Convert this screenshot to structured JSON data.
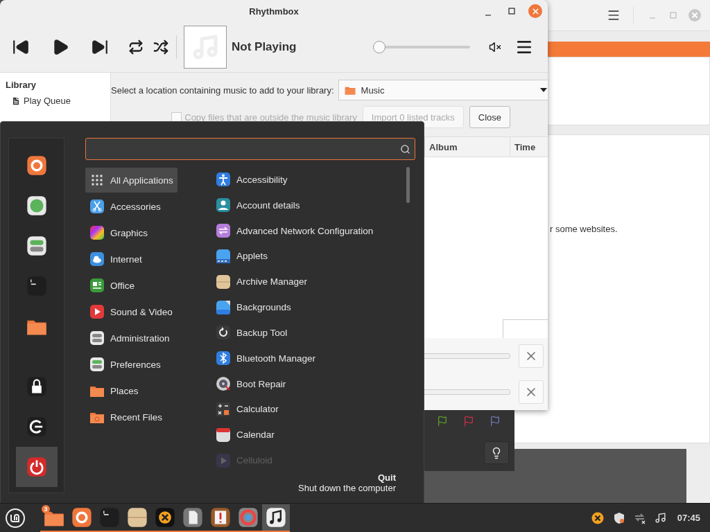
{
  "rhythmbox": {
    "title": "Rhythmbox",
    "now_playing": "Not Playing",
    "volume": {
      "level": 0,
      "muted": true
    },
    "sidebar": {
      "heading": "Library",
      "items": [
        {
          "label": "Play Queue"
        }
      ]
    },
    "import_bar": {
      "prompt": "Select a location containing music to add to your library:",
      "location": "Music",
      "copy_files": {
        "label": "Copy files that are outside the music library",
        "checked": false,
        "disabled": true
      },
      "buttons": [
        {
          "label": "Import 0 listed tracks",
          "disabled": true
        },
        {
          "label": "Close",
          "disabled": false
        }
      ]
    },
    "columns": [
      "Album",
      "Time"
    ],
    "transfers": [
      {
        "level": 0
      },
      {
        "level": 0
      }
    ]
  },
  "background_window": {
    "text": "r some websites."
  },
  "menu": {
    "favorites": [
      {
        "selected": false
      },
      {
        "selected": false
      },
      {
        "selected": false
      },
      {
        "selected": false
      },
      {
        "selected": false
      },
      {
        "selected": false
      },
      {
        "selected": false
      },
      {
        "selected": true
      }
    ],
    "categories": [
      {
        "label": "All Applications",
        "selected": true
      },
      {
        "label": "Accessories",
        "selected": false
      },
      {
        "label": "Graphics",
        "selected": false
      },
      {
        "label": "Internet",
        "selected": false
      },
      {
        "label": "Office",
        "selected": false
      },
      {
        "label": "Sound & Video",
        "selected": false
      },
      {
        "label": "Administration",
        "selected": false
      },
      {
        "label": "Preferences",
        "selected": false
      },
      {
        "label": "Places",
        "selected": false
      },
      {
        "label": "Recent Files",
        "selected": false
      }
    ],
    "apps": [
      {
        "label": "Accessibility",
        "faded": false
      },
      {
        "label": "Account details",
        "faded": false
      },
      {
        "label": "Advanced Network Configuration",
        "faded": false
      },
      {
        "label": "Applets",
        "faded": false
      },
      {
        "label": "Archive Manager",
        "faded": false
      },
      {
        "label": "Backgrounds",
        "faded": false
      },
      {
        "label": "Backup Tool",
        "faded": false
      },
      {
        "label": "Bluetooth Manager",
        "faded": false
      },
      {
        "label": "Boot Repair",
        "faded": false
      },
      {
        "label": "Calculator",
        "faded": false
      },
      {
        "label": "Calendar",
        "faded": false
      },
      {
        "label": "Celluloid",
        "faded": true
      }
    ],
    "status": {
      "title": "Quit",
      "description": "Shut down the computer"
    }
  },
  "taskbar": {
    "launchers": [
      {
        "running": true,
        "selected": false,
        "badge": "3"
      },
      {
        "running": true,
        "selected": false
      },
      {
        "running": true,
        "selected": false
      },
      {
        "running": true,
        "selected": false
      },
      {
        "running": true,
        "selected": false
      },
      {
        "running": true,
        "selected": false
      },
      {
        "running": true,
        "selected": false
      },
      {
        "running": true,
        "selected": false
      },
      {
        "running": true,
        "selected": true
      }
    ],
    "clock": "07:45"
  }
}
